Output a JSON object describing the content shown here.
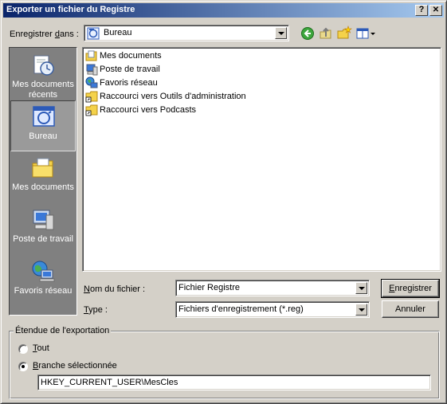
{
  "window": {
    "title": "Exporter un fichier du Registre",
    "help_button": "?",
    "close_button": "✕"
  },
  "save_in": {
    "label_prefix": "Enregistrer ",
    "label_accel": "d",
    "label_suffix": "ans :",
    "value": "Bureau",
    "icon": "desktop-icon"
  },
  "toolbar": {
    "back_icon": "back-arrow-icon",
    "up_icon": "up-folder-icon",
    "new_folder_icon": "new-folder-icon",
    "view_menu_icon": "view-menu-icon"
  },
  "places": [
    {
      "label": "Mes documents récents",
      "icon": "recent-documents-icon"
    },
    {
      "label": "Bureau",
      "icon": "desktop-icon",
      "selected": true
    },
    {
      "label": "Mes documents",
      "icon": "my-documents-icon"
    },
    {
      "label": "Poste de travail",
      "icon": "my-computer-icon"
    },
    {
      "label": "Favoris réseau",
      "icon": "network-places-icon"
    }
  ],
  "files": [
    {
      "label": "Mes documents",
      "icon": "my-documents-icon"
    },
    {
      "label": "Poste de travail",
      "icon": "my-computer-icon"
    },
    {
      "label": "Favoris réseau",
      "icon": "network-places-icon"
    },
    {
      "label": "Raccourci vers Outils d'administration",
      "icon": "shortcut-folder-icon"
    },
    {
      "label": "Raccourci vers Podcasts",
      "icon": "shortcut-folder-icon"
    }
  ],
  "filename": {
    "label_accel": "N",
    "label_rest": "om du fichier :",
    "value": "Fichier Registre"
  },
  "filetype": {
    "label_accel": "T",
    "label_rest": "ype :",
    "value": "Fichiers d'enregistrement (*.reg)"
  },
  "buttons": {
    "save_accel": "E",
    "save_rest": "nregistrer",
    "cancel": "Annuler"
  },
  "export_range": {
    "title": "Étendue de l'exportation",
    "all_accel": "T",
    "all_rest": "out",
    "branch_accel": "B",
    "branch_rest": "ranche sélectionnée",
    "selected": "branch",
    "branch_value": "HKEY_CURRENT_USER\\MesCles"
  }
}
